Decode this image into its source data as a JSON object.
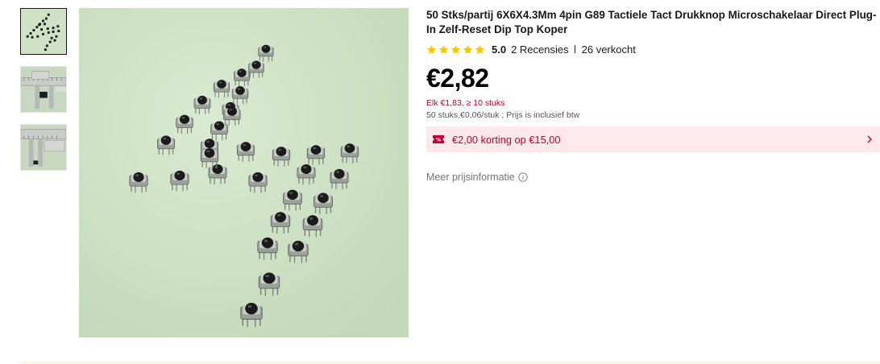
{
  "product": {
    "title": "50 Stks/partij 6X6X4.3Mm 4pin G89 Tactiele Tact Drukknop Microschakelaar Direct Plug-In Zelf-Reset Dip Top Koper",
    "rating": "5.0",
    "reviews": "2 Recensies",
    "sold": "26 verkocht",
    "price": "€2,82",
    "bulk_price": "Elk €1,83, ≥ 10 stuks",
    "unit_info": "50 stuks,€0,06/stuk ; Prijs is inclusief btw",
    "coupon": "€2,00 korting op €15,00",
    "more_price_info": "Meer prijsinformatie"
  },
  "thumbnails": [
    "switches-pattern",
    "caliper-measure-1",
    "caliper-measure-2"
  ],
  "colors": {
    "star": "#ffc300",
    "accent_red": "#c3002f",
    "coupon_bg": "#fde9ec",
    "image_bg": "#cfe2c6"
  },
  "icons": [
    "star-icon",
    "coupon-icon",
    "chevron-right-icon",
    "info-icon"
  ]
}
